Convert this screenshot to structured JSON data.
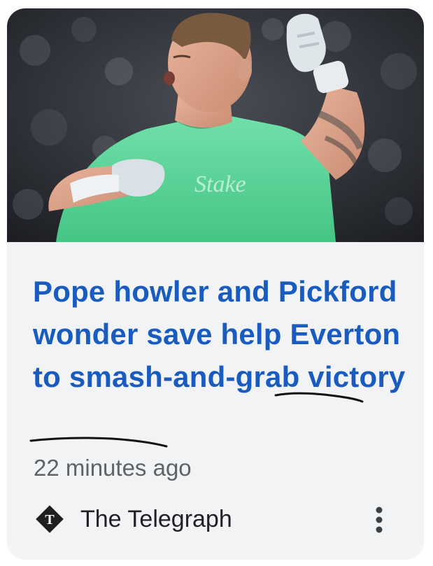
{
  "article": {
    "headline": "Pope howler and Pickford wonder save help Everton to smash-and-grab victory",
    "timestamp": "22 minutes ago",
    "source_name": "The Telegraph",
    "source_logo_letter": "T",
    "image_text": "Stake"
  },
  "icons": {
    "source_logo": "telegraph-logo-icon",
    "more": "more-vert-icon"
  },
  "colors": {
    "headline": "#1a5bbf",
    "card_background": "#f1f3f4",
    "timestamp": "#5f6368",
    "jersey": "#5fd39a",
    "annotation_ink": "#111111"
  }
}
